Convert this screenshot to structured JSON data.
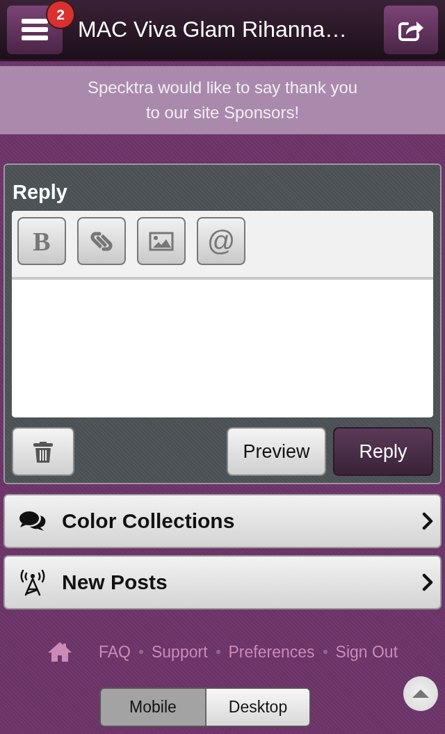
{
  "header": {
    "menu_badge": "2",
    "title": "MAC Viva Glam Rihanna…"
  },
  "banner": {
    "lines": [
      "Specktra would like to say thank you",
      "to our site Sponsors!"
    ]
  },
  "reply_panel": {
    "title": "Reply",
    "toolbar": [
      {
        "kind": "bold",
        "label": "B"
      },
      {
        "kind": "link"
      },
      {
        "kind": "image"
      },
      {
        "kind": "mention",
        "label": "@"
      }
    ],
    "buttons": [
      {
        "kind": "delete"
      },
      {
        "kind": "secondary",
        "label": "Preview"
      },
      {
        "kind": "primary",
        "label": "Reply"
      }
    ]
  },
  "nav_items": [
    {
      "kind": "chat",
      "label": "Color Collections"
    },
    {
      "kind": "antenna",
      "label": "New Posts"
    }
  ],
  "footer": {
    "links": [
      "FAQ",
      "Support",
      "Preferences",
      "Sign Out"
    ],
    "view_modes": [
      {
        "label": "Mobile",
        "selected": true
      },
      {
        "label": "Desktop",
        "selected": false
      }
    ]
  }
}
